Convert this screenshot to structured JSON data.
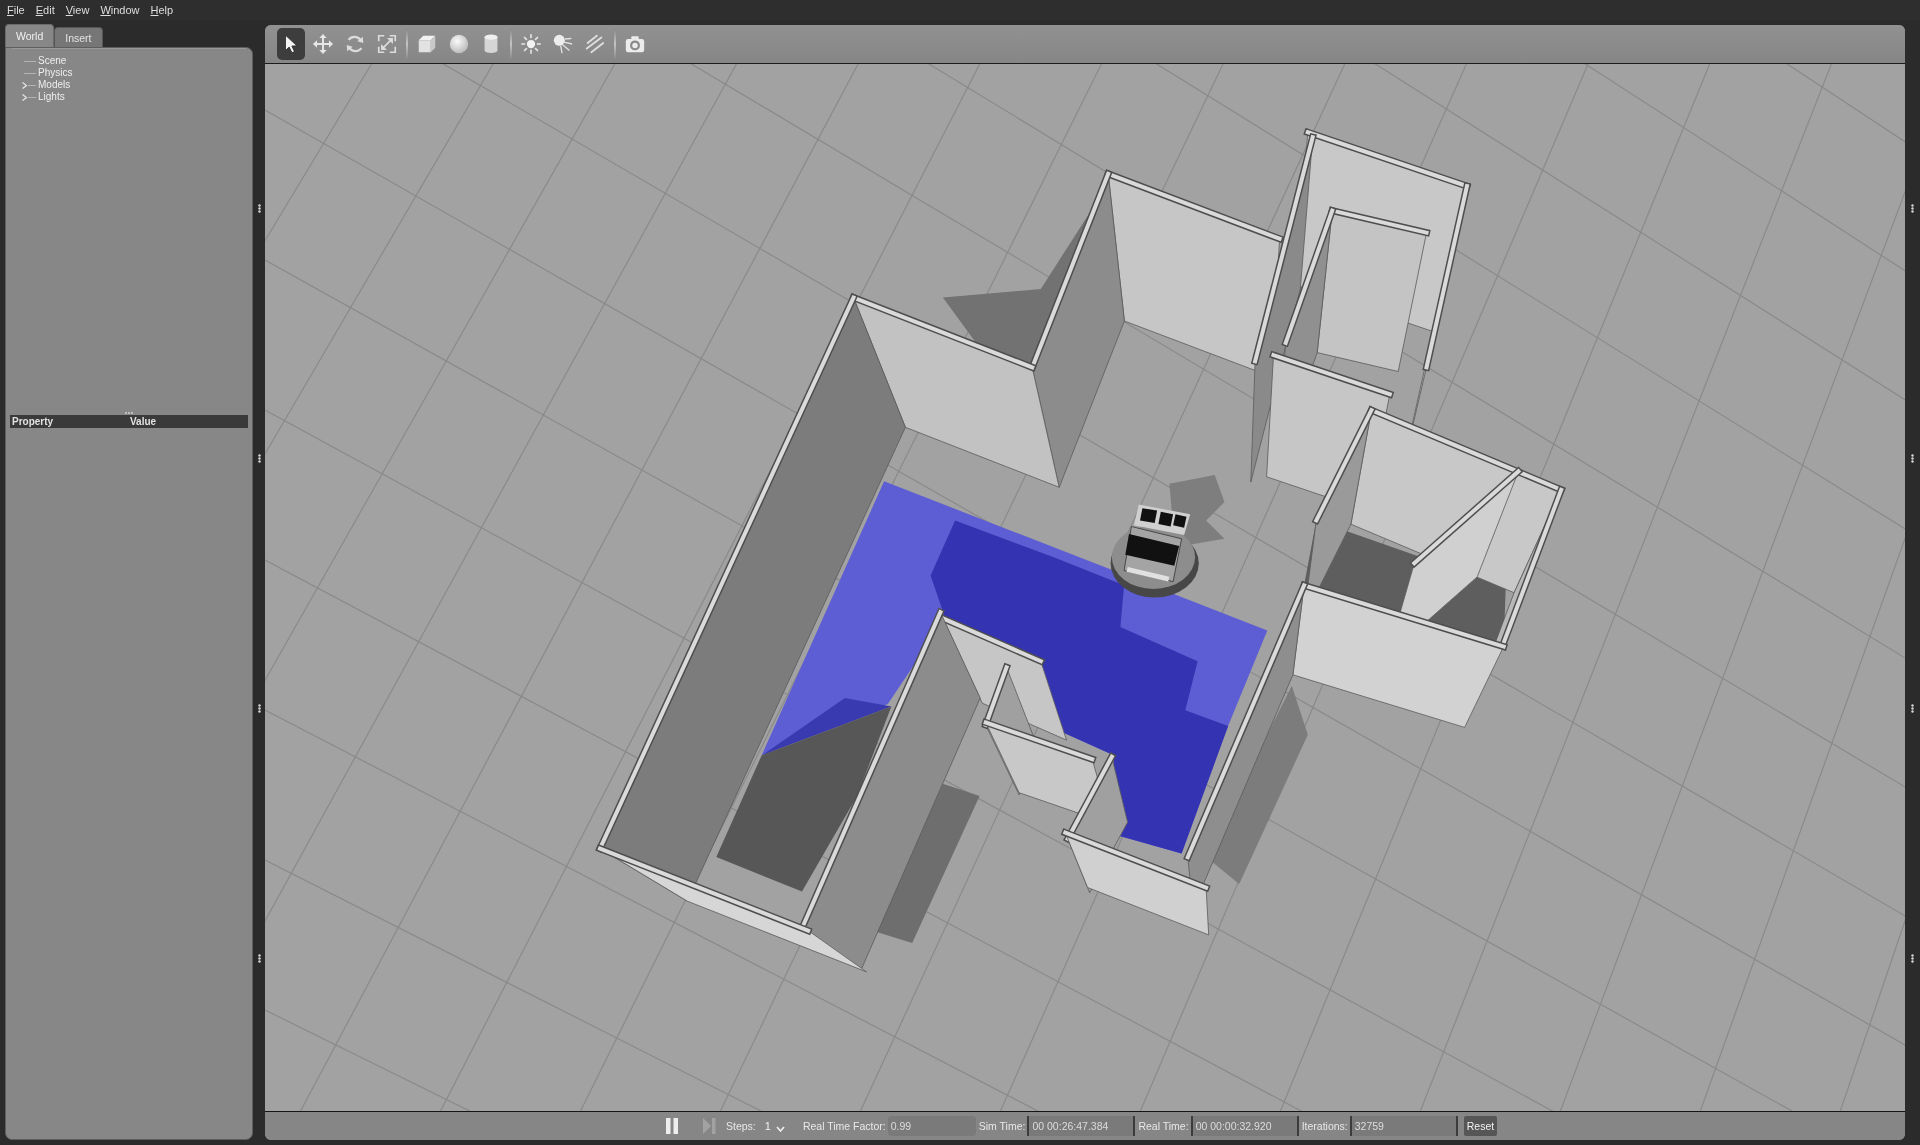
{
  "menu_bar": {
    "items": [
      "File",
      "Edit",
      "View",
      "Window",
      "Help"
    ]
  },
  "left_panel": {
    "tabs": [
      {
        "label": "World",
        "selected": true
      },
      {
        "label": "Insert",
        "selected": false
      }
    ],
    "tree": [
      {
        "label": "Scene",
        "kind": "leaf"
      },
      {
        "label": "Physics",
        "kind": "leaf"
      },
      {
        "label": "Models",
        "kind": "group",
        "expanded": false
      },
      {
        "label": "Lights",
        "kind": "group",
        "expanded": false
      }
    ],
    "property_table": {
      "columns": [
        "Property",
        "Value"
      ]
    }
  },
  "toolbar": {
    "tools": [
      {
        "selected": true
      },
      {
        "selected": false
      },
      {
        "selected": false
      },
      {
        "selected": false
      },
      {
        "selected": false
      },
      {
        "selected": false
      },
      {
        "selected": false
      },
      {
        "selected": false
      },
      {
        "selected": false
      },
      {
        "selected": false
      },
      {
        "selected": false
      }
    ]
  },
  "bottom_bar": {
    "play_button": {
      "paused": false
    },
    "step_button": {
      "disabled": true
    },
    "steps_label": "Steps:",
    "steps_value": "1",
    "fields": [
      {
        "label": "Real Time Factor:",
        "value": "0.99"
      },
      {
        "label": "Sim Time:",
        "value": "00 00:26:47.384"
      },
      {
        "label": "Real Time:",
        "value": "00 00:00:32.920"
      },
      {
        "label": "Iterations:",
        "value": "32759"
      }
    ],
    "reset_button": {
      "label": "Reset"
    }
  }
}
